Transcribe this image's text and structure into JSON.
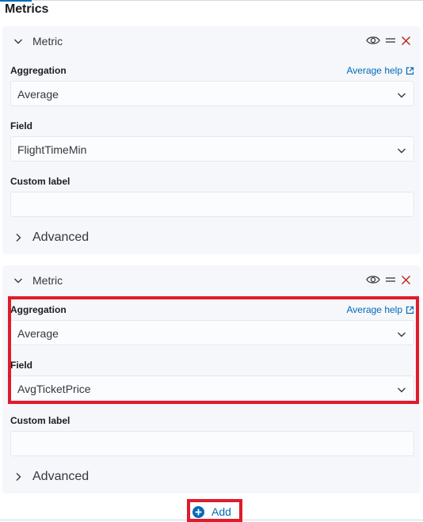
{
  "section": {
    "title": "Metrics"
  },
  "metrics": [
    {
      "title": "Metric",
      "aggregation_label": "Aggregation",
      "help_link": "Average help",
      "aggregation_value": "Average",
      "field_label": "Field",
      "field_value": "FlightTimeMin",
      "custom_label": "Custom label",
      "custom_label_value": "",
      "advanced_label": "Advanced"
    },
    {
      "title": "Metric",
      "aggregation_label": "Aggregation",
      "help_link": "Average help",
      "aggregation_value": "Average",
      "field_label": "Field",
      "field_value": "AvgTicketPrice",
      "custom_label": "Custom label",
      "custom_label_value": "",
      "advanced_label": "Advanced"
    }
  ],
  "add_button": {
    "label": "Add"
  },
  "icons": {
    "collapse": "chevron-down-icon",
    "toggle_visibility": "eye-icon",
    "drag_handle": "drag-handle-icon",
    "remove": "close-icon",
    "external_link": "external-link-icon",
    "advanced": "chevron-right-icon",
    "add": "plus-circle-icon"
  },
  "colors": {
    "accent": "#006bb8",
    "danger": "#bd271e",
    "highlight": "#e01b2b",
    "panel_bg": "#f5f7fa"
  }
}
